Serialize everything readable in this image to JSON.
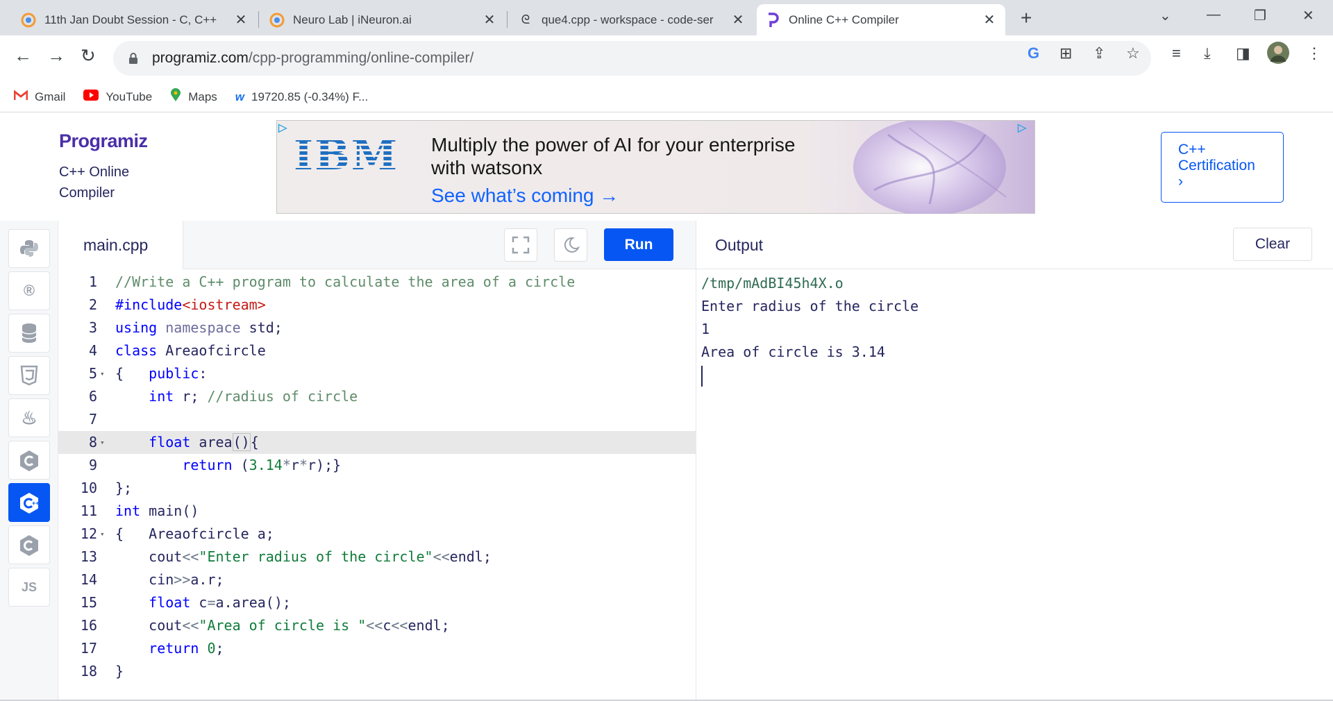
{
  "browser": {
    "tabs": [
      {
        "title": "11th Jan Doubt Session - C, C++",
        "close": "✕"
      },
      {
        "title": "Neuro Lab | iNeuron.ai",
        "close": "✕"
      },
      {
        "title": "que4.cpp - workspace - code-ser",
        "close": "✕"
      },
      {
        "title": "Online C++ Compiler",
        "close": "✕"
      }
    ],
    "new_tab": "+",
    "url_host": "programiz.com",
    "url_path": "/cpp-programming/online-compiler/",
    "bookmarks": [
      {
        "label": "Gmail"
      },
      {
        "label": "YouTube"
      },
      {
        "label": "Maps"
      },
      {
        "label": "19720.85 (-0.34%) F..."
      }
    ]
  },
  "site": {
    "logo": "Programiz",
    "subtitle": "C++ Online Compiler",
    "certification": "C++ Certification"
  },
  "ad": {
    "brand": "IBM",
    "headline": "Multiply the power of AI for your enterprise with watsonx",
    "cta": "See what’s coming →"
  },
  "editor": {
    "file_name": "main.cpp",
    "run_label": "Run",
    "highlighted_line": 8
  },
  "output": {
    "title": "Output",
    "clear_label": "Clear",
    "lines": [
      "/tmp/mAdBI45h4X.o",
      "Enter radius of the circle",
      "1",
      "Area of circle is 3.14"
    ]
  },
  "languages": [
    "python",
    "r",
    "sql",
    "html",
    "java",
    "c",
    "cpp",
    "csharp",
    "js"
  ],
  "colors": {
    "accent": "#0556f3",
    "brand": "#4a2fa8"
  }
}
